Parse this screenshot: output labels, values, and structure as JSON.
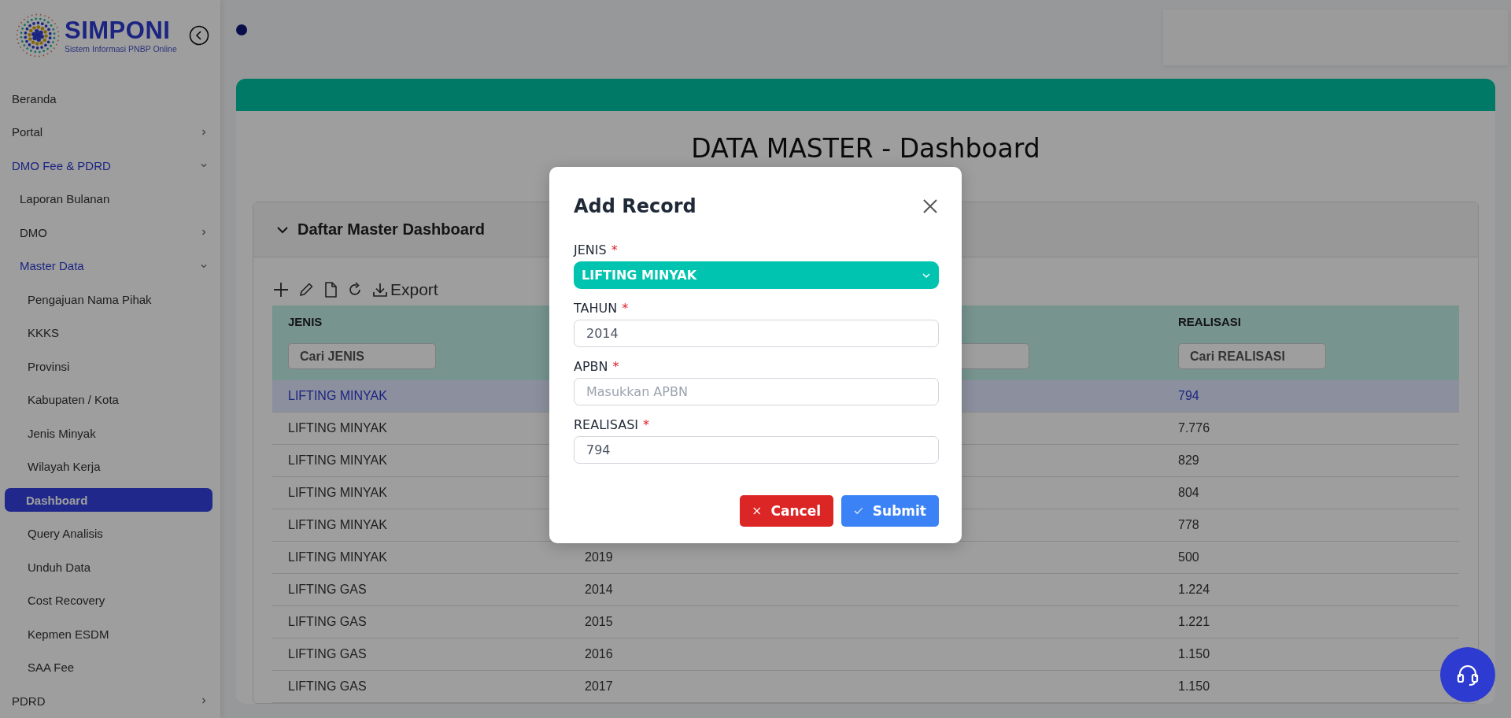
{
  "sidebar": {
    "logo": {
      "name": "SIMPONI",
      "tagline": "Sistem Informasi PNBP Online"
    },
    "items": [
      {
        "label": "Beranda",
        "selected": false
      },
      {
        "label": "Portal",
        "selected": false,
        "expanded": false,
        "in_path": false
      },
      {
        "label": "DMO Fee & PDRD",
        "selected": false,
        "expanded": true,
        "in_path": true,
        "children": [
          {
            "label": "Laporan Bulanan",
            "selected": false
          },
          {
            "label": "DMO",
            "selected": false,
            "expanded": false,
            "in_path": false
          },
          {
            "label": "Master Data",
            "selected": false,
            "expanded": true,
            "in_path": true,
            "children": [
              {
                "label": "Pengajuan Nama Pihak",
                "selected": false
              },
              {
                "label": "KKKS",
                "selected": false
              },
              {
                "label": "Provinsi",
                "selected": false
              },
              {
                "label": "Kabupaten / Kota",
                "selected": false
              },
              {
                "label": "Jenis Minyak",
                "selected": false
              },
              {
                "label": "Wilayah Kerja",
                "selected": false
              },
              {
                "label": "Dashboard",
                "selected": true
              },
              {
                "label": "Query Analisis",
                "selected": false
              },
              {
                "label": "Unduh Data",
                "selected": false
              },
              {
                "label": "Cost Recovery",
                "selected": false
              },
              {
                "label": "Kepmen ESDM",
                "selected": false
              },
              {
                "label": "SAA Fee",
                "selected": false
              }
            ]
          }
        ]
      },
      {
        "label": "PDRD",
        "selected": false,
        "expanded": false,
        "in_path": false
      }
    ]
  },
  "page": {
    "title": "DATA MASTER - Dashboard",
    "panel": {
      "title": "Daftar Master Dashboard",
      "expanded": true
    },
    "toolbar": {
      "export_label": "Export"
    },
    "table": {
      "columns": [
        {
          "kind": "labeled",
          "header": "JENIS",
          "filter_placeholder": "Cari JENIS"
        },
        {
          "kind": "covered"
        },
        {
          "kind": "filter-only"
        },
        {
          "kind": "labeled",
          "header": "REALISASI",
          "filter_placeholder": "Cari REALISASI"
        }
      ],
      "rows": [
        {
          "jenis": "LIFTING MINYAK",
          "realisasi": "794",
          "selected": true
        },
        {
          "jenis": "LIFTING MINYAK",
          "realisasi": "7.776",
          "selected": false
        },
        {
          "jenis": "LIFTING MINYAK",
          "realisasi": "829",
          "selected": false
        },
        {
          "jenis": "LIFTING MINYAK",
          "realisasi": "804",
          "selected": false
        },
        {
          "jenis": "LIFTING MINYAK",
          "realisasi": "778",
          "selected": false
        },
        {
          "jenis": "LIFTING MINYAK",
          "tahun": "2019",
          "realisasi": "500",
          "selected": false
        },
        {
          "jenis": "LIFTING GAS",
          "tahun": "2014",
          "realisasi": "1.224",
          "selected": false
        },
        {
          "jenis": "LIFTING GAS",
          "tahun": "2015",
          "realisasi": "1.221",
          "selected": false
        },
        {
          "jenis": "LIFTING GAS",
          "tahun": "2016",
          "realisasi": "1.150",
          "selected": false
        },
        {
          "jenis": "LIFTING GAS",
          "tahun": "2017",
          "realisasi": "1.150",
          "selected": false
        }
      ]
    }
  },
  "modal": {
    "title": "Add Record",
    "fields": [
      {
        "label": "JENIS",
        "required_mark": "*",
        "kind": "select",
        "value": "LIFTING MINYAK"
      },
      {
        "label": "TAHUN",
        "required_mark": "*",
        "kind": "text",
        "value": "2014"
      },
      {
        "label": "APBN",
        "required_mark": "*",
        "kind": "text",
        "placeholder": "Masukkan APBN"
      },
      {
        "label": "REALISASI",
        "required_mark": "*",
        "kind": "text",
        "value": "794"
      }
    ],
    "buttons": [
      {
        "label": "Cancel",
        "kind": "cancel"
      },
      {
        "label": "Submit",
        "kind": "submit"
      }
    ]
  }
}
